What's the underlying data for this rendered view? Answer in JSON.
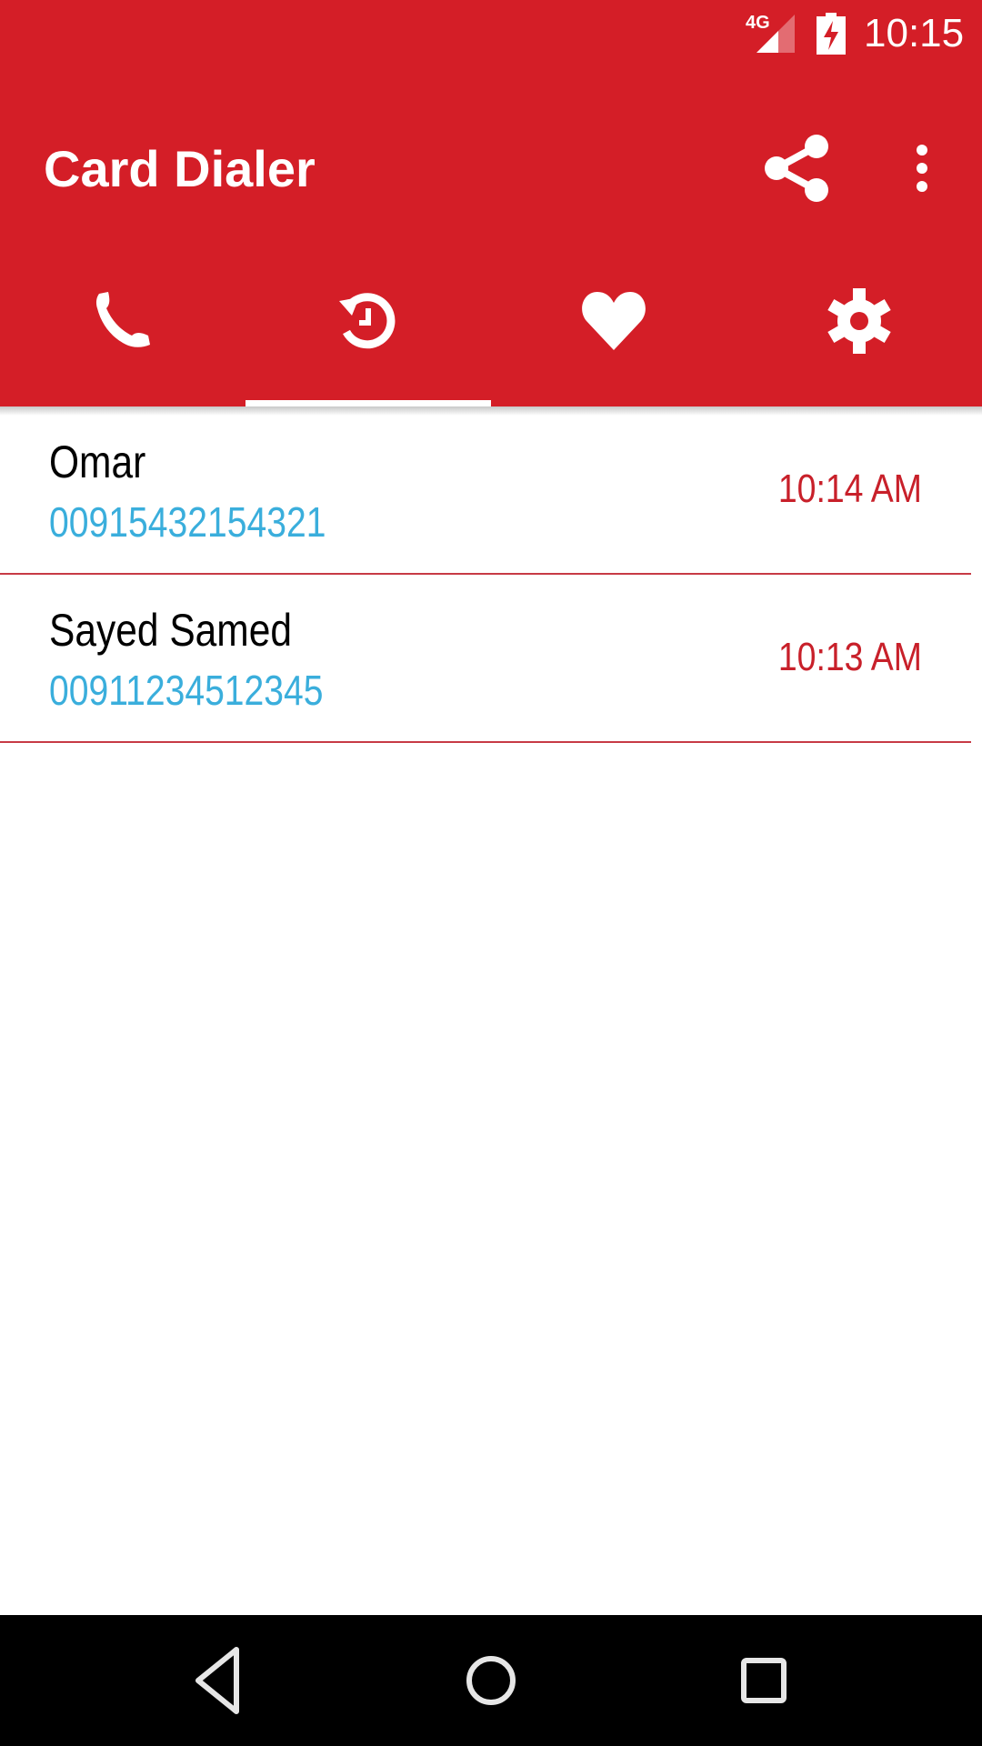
{
  "status_bar": {
    "network_type": "4G",
    "time": "10:15",
    "icons": [
      "signal-icon",
      "battery-charging-icon"
    ]
  },
  "app_bar": {
    "title": "Card Dialer",
    "actions": [
      "share-icon",
      "more-vert-icon"
    ]
  },
  "tabs": [
    {
      "label": "Call",
      "icon": "phone-icon",
      "active": false
    },
    {
      "label": "History",
      "icon": "history-icon",
      "active": true
    },
    {
      "label": "Favourites",
      "icon": "heart-icon",
      "active": false
    },
    {
      "label": "Settings",
      "icon": "gear-icon",
      "active": false
    }
  ],
  "history": [
    {
      "name": "Omar",
      "number": "00915432154321",
      "time": "10:14 AM"
    },
    {
      "name": "Sayed Samed",
      "number": "00911234512345",
      "time": "10:13 AM"
    }
  ],
  "nav_bar": [
    "back-icon",
    "home-icon",
    "recents-icon"
  ],
  "colors": {
    "primary": "#d41e27",
    "number": "#3aaedc",
    "time": "#c8202a",
    "divider": "#c73a45"
  }
}
